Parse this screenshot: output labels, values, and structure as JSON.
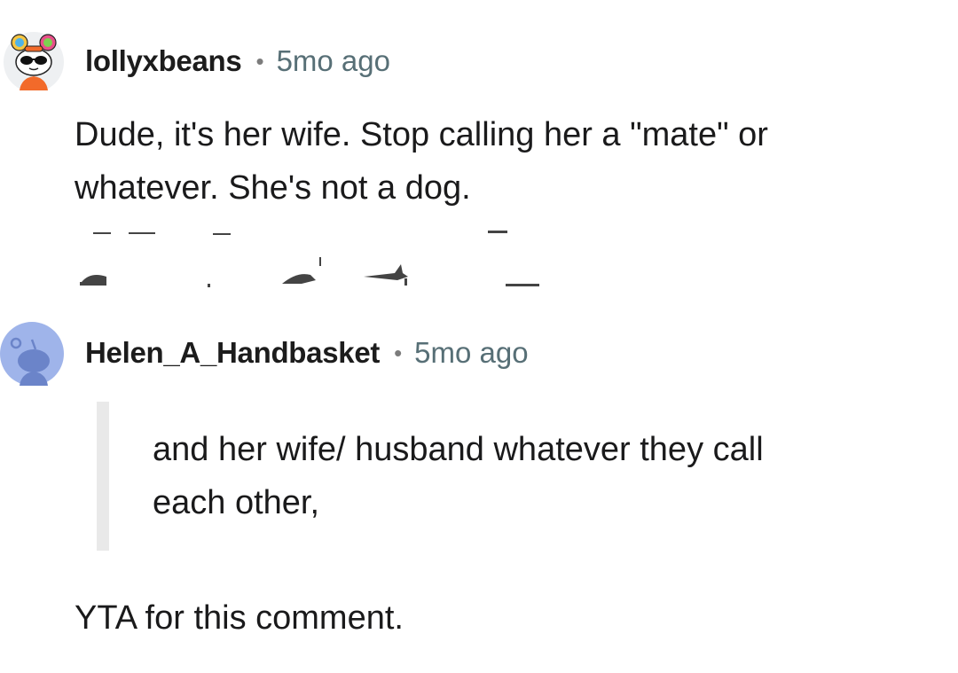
{
  "comments": [
    {
      "username": "lollyxbeans",
      "separator": "•",
      "time": "5mo ago",
      "avatar_icon": "snoo-avatar-sunglasses-icon",
      "lines": [
        "Dude, it's her wife. Stop calling her a \"mate\" or",
        "whatever. She's not a dog."
      ]
    },
    {
      "username": "Helen_A_Handbasket",
      "separator": "•",
      "time": "5mo ago",
      "avatar_icon": "default-snoo-avatar-icon",
      "quote_lines": [
        "and her wife/ husband whatever they call",
        "each other,"
      ],
      "reply_text": "YTA for this comment."
    }
  ],
  "colors": {
    "username": "#1c1c1c",
    "timestamp": "#576f76",
    "quote_bar": "#e9e9e9",
    "default_avatar_bg": "#9fb4ea",
    "default_avatar_figure": "#6b84c9"
  }
}
